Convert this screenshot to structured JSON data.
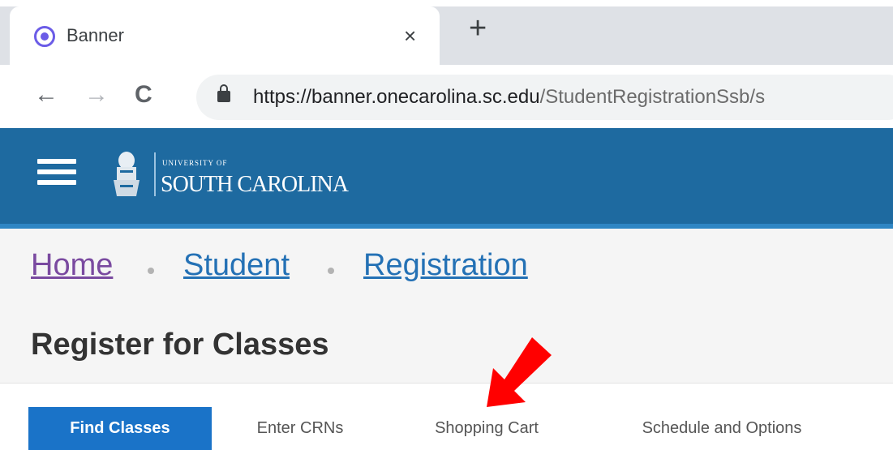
{
  "browser": {
    "tab_title": "Banner",
    "tab_close": "×",
    "new_tab": "+",
    "url_host": "https://banner.onecarolina.sc.edu",
    "url_path": "/StudentRegistrationSsb/s",
    "nav": {
      "back": "←",
      "forward": "→",
      "reload": "C"
    }
  },
  "header": {
    "logo_small": "UNIVERSITY OF",
    "logo_big": "SOUTH CAROLINA",
    "brand_color": "#1e6aa0"
  },
  "breadcrumb": {
    "items": [
      "Home",
      "Student",
      "Registration"
    ]
  },
  "page": {
    "title": "Register for Classes"
  },
  "registration_tabs": {
    "items": [
      "Find Classes",
      "Enter CRNs",
      "Shopping Cart",
      "Schedule and Options"
    ],
    "active": "Find Classes"
  },
  "annotation": {
    "arrow_color": "#ff0000",
    "points_to": "Shopping Cart"
  }
}
